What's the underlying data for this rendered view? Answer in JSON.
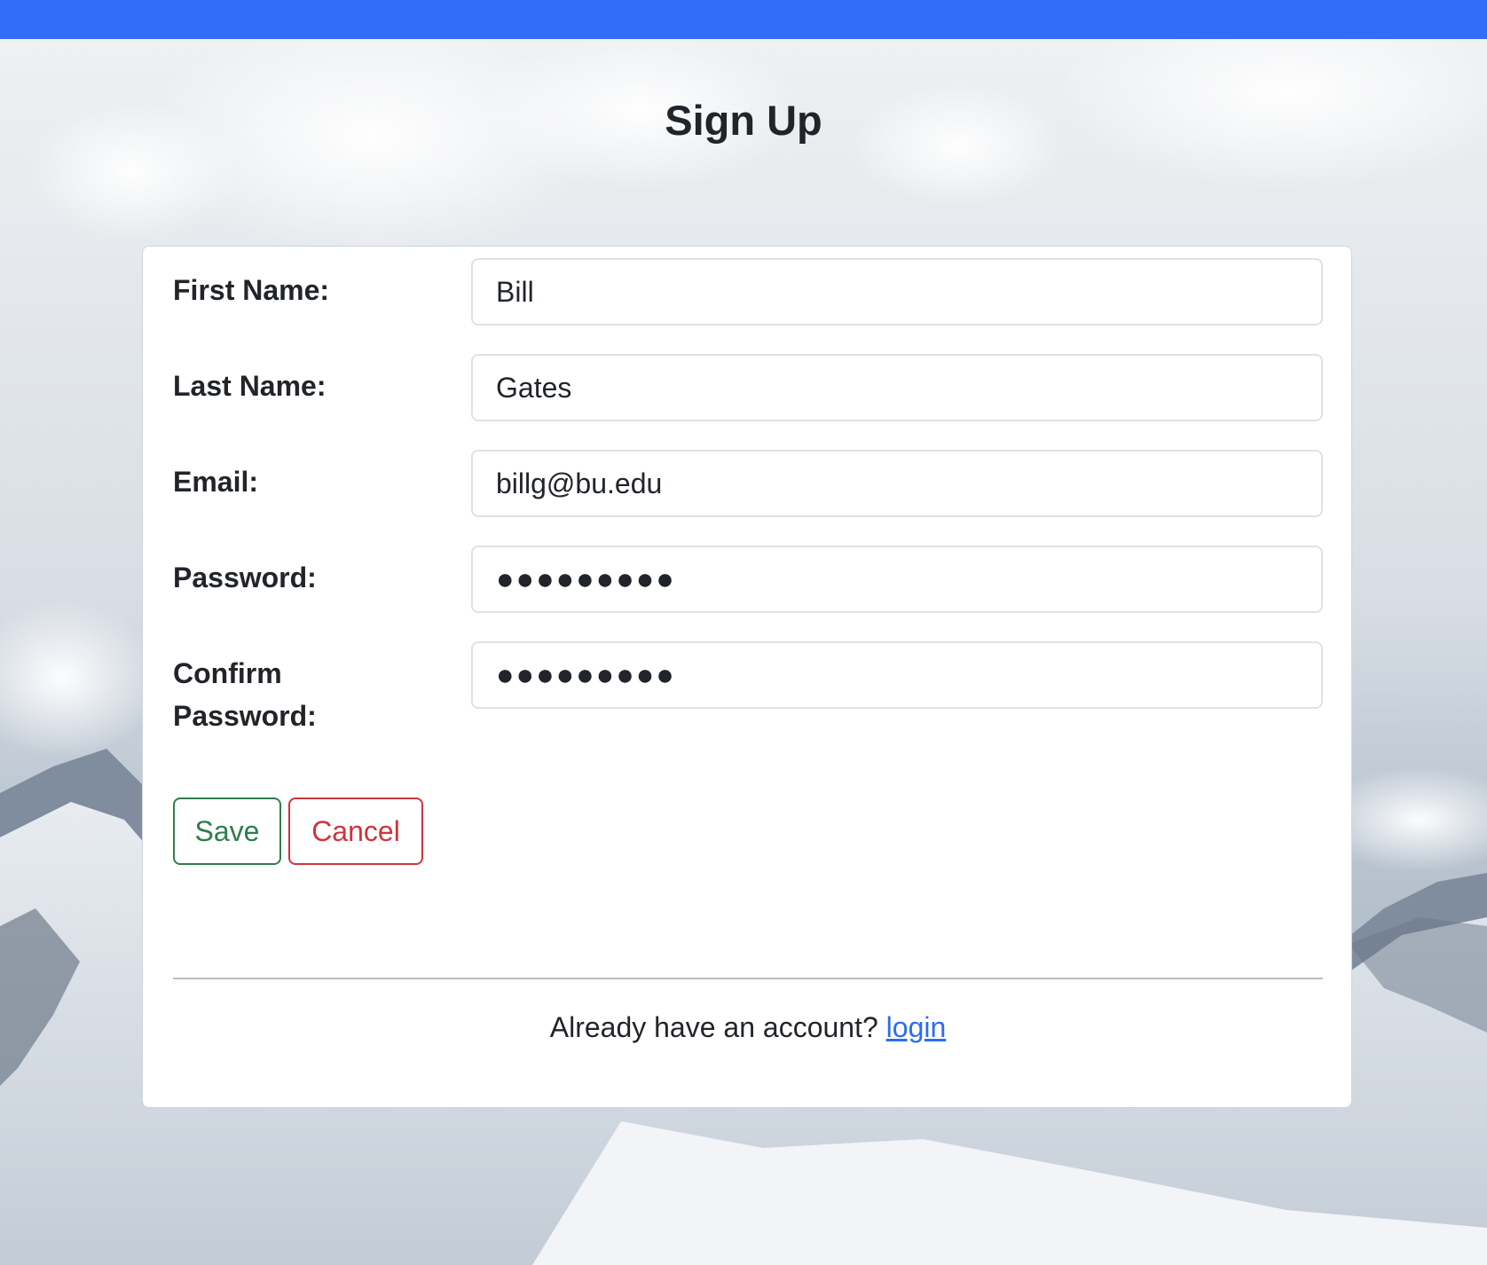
{
  "header": {
    "bar_color": "#336cf6"
  },
  "page": {
    "title": "Sign Up"
  },
  "form": {
    "fields": [
      {
        "label": "First Name:",
        "value": "Bill",
        "type": "text"
      },
      {
        "label": "Last Name:",
        "value": "Gates",
        "type": "text"
      },
      {
        "label": "Email:",
        "value": "billg@bu.edu",
        "type": "email"
      },
      {
        "label": "Password:",
        "value": "●●●●●●●●●",
        "type": "password"
      },
      {
        "label": "Confirm Password:",
        "value": "●●●●●●●●●",
        "type": "password"
      }
    ],
    "save_label": "Save",
    "cancel_label": "Cancel"
  },
  "footer": {
    "prompt": "Already have an account?",
    "link_label": "login"
  },
  "colors": {
    "save": "#2f7d4f",
    "cancel": "#d0343c",
    "link": "#2d6cf0"
  }
}
